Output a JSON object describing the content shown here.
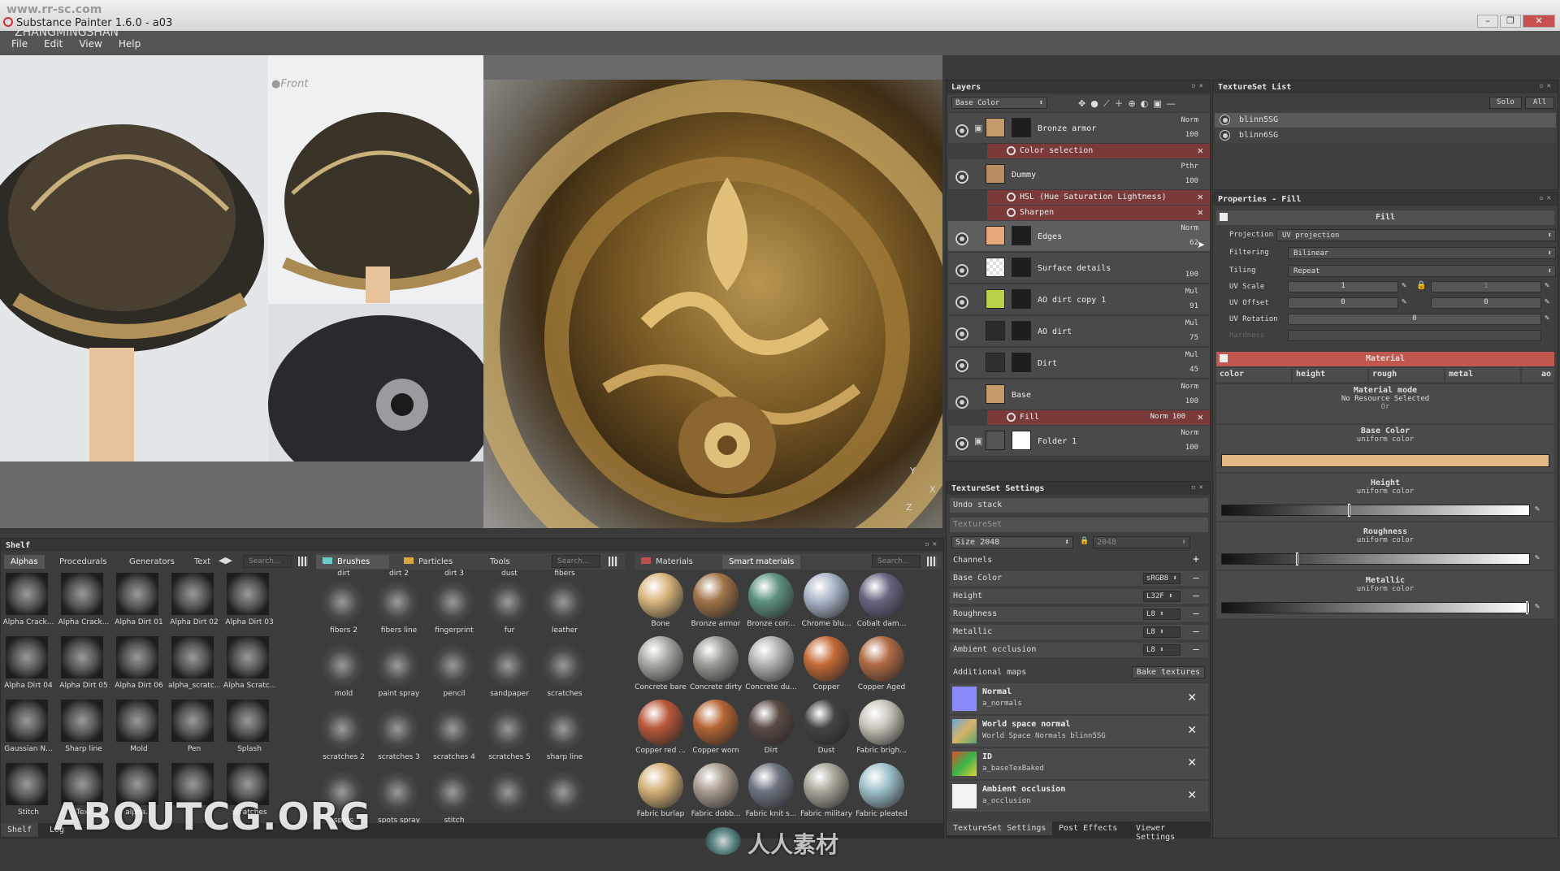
{
  "window": {
    "title": "Substance Painter 1.6.0 - a03",
    "watermark_top": "www.rr-sc.com",
    "watermark_top2": "ZHANGMINGSHAN",
    "watermark_bottom": "ABOUTCG.ORG",
    "watermark_center": "人人素材",
    "buttons": [
      "–",
      "❐",
      "✕"
    ]
  },
  "menu": [
    "File",
    "Edit",
    "View",
    "Help"
  ],
  "viewport": {
    "reference_label": "Front",
    "axis_y": "Y",
    "axis_z": "Z",
    "axis_x": "X"
  },
  "layers": {
    "title": "Layers",
    "channel_select": "Base Color",
    "items": [
      {
        "name": "Bronze armor",
        "blend": "Norm",
        "opacity": "100",
        "swatch": "#c39a6b",
        "is_folder": true
      },
      {
        "name": "Dummy",
        "blend": "Pthr",
        "opacity": "100",
        "swatch": "#b88d62"
      },
      {
        "name": "Edges",
        "blend": "Norm",
        "opacity": "62",
        "swatch": "#e9a87a",
        "selected": true
      },
      {
        "name": "Surface details",
        "blend": "",
        "opacity": "100",
        "swatch": "#f0f0f0"
      },
      {
        "name": "AO dirt copy 1",
        "blend": "Mul",
        "opacity": "91",
        "swatch": "#b7d24a"
      },
      {
        "name": "AO dirt",
        "blend": "Mul",
        "opacity": "75",
        "swatch": "#2b2b2b"
      },
      {
        "name": "Dirt",
        "blend": "Mul",
        "opacity": "45",
        "swatch": "#303030"
      },
      {
        "name": "Base",
        "blend": "Norm",
        "opacity": "100",
        "swatch": "#c69a6a"
      },
      {
        "name": "Folder 1",
        "blend": "Norm",
        "opacity": "100",
        "swatch": "#555555",
        "is_folder": true
      }
    ],
    "effects": {
      "color_selection": "Color selection",
      "hsl": "HSL (Hue Saturation Lightness)",
      "sharpen": "Sharpen",
      "fill": "Fill",
      "fill_blend": "Norm",
      "fill_opacity": "100"
    }
  },
  "textureset_list": {
    "title": "TextureSet List",
    "solo": "Solo",
    "all": "All",
    "items": [
      "blinn5SG",
      "blinn6SG"
    ]
  },
  "properties": {
    "title": "Properties - Fill",
    "fill_header": "Fill",
    "projection_label": "Projection",
    "projection_value": "UV projection",
    "filtering_label": "Filtering",
    "filtering_value": "Bilinear",
    "tiling_label": "Tiling",
    "tiling_value": "Repeat",
    "uv_scale_label": "UV Scale",
    "uv_scale_value": "1",
    "uv_scale_value2": "1",
    "uv_offset_label": "UV Offset",
    "uv_offset_value": "0",
    "uv_offset_value2": "0",
    "uv_rotation_label": "UV Rotation",
    "uv_rotation_value": "0",
    "hardness_label": "Hardness",
    "material_header": "Material",
    "channels": [
      "color",
      "height",
      "rough",
      "metal",
      "ao"
    ],
    "material_mode": "Material mode",
    "no_resource": "No Resource Selected",
    "or": "Or",
    "base_color": "Base Color",
    "uniform_color": "uniform color",
    "base_color_hex": "#e3b882",
    "height": "Height",
    "roughness": "Roughness",
    "metallic": "Metallic",
    "height_level": 0.41,
    "roughness_level": 0.24,
    "metallic_level": 0.99,
    "ramp_ticks": [
      "0",
      "0.1",
      "0.2",
      "0.3",
      "0.4",
      "0.5",
      "0.6",
      "0.7",
      "0.8",
      "0.9"
    ]
  },
  "textureset_settings": {
    "title": "TextureSet Settings",
    "undo_stack": "Undo stack",
    "textureset": "TextureSet",
    "size_label": "Size",
    "size_value": "2048",
    "size_value2": "2048",
    "channels_label": "Channels",
    "channels": [
      {
        "name": "Base Color",
        "format": "sRGB8"
      },
      {
        "name": "Height",
        "format": "L32F"
      },
      {
        "name": "Roughness",
        "format": "L8"
      },
      {
        "name": "Metallic",
        "format": "L8"
      },
      {
        "name": "Ambient occlusion",
        "format": "L8"
      }
    ],
    "additional_maps": "Additional maps",
    "bake_textures": "Bake textures",
    "maps": [
      {
        "name": "Normal",
        "file": "a_normals",
        "color": "#8a8aff"
      },
      {
        "name": "World space normal",
        "file": "World Space Normals blinn5SG",
        "color": "#8ab6d6"
      },
      {
        "name": "ID",
        "file": "a_baseTexBaked",
        "color": "#d9502f"
      },
      {
        "name": "Ambient occlusion",
        "file": "a_occlusion",
        "color": "#f2f2f2"
      }
    ],
    "bottom_tabs": [
      "TextureSet Settings",
      "Post Effects",
      "Viewer Settings"
    ]
  },
  "shelf": {
    "title": "Shelf",
    "tabs_left": [
      "Alphas",
      "Procedurals",
      "Generators",
      "Text"
    ],
    "search": "Search...",
    "alphas": [
      "Alpha Crack...",
      "Alpha Crack...",
      "Alpha Dirt 01",
      "Alpha Dirt 02",
      "Alpha Dirt 03",
      "Alpha Dirt 04",
      "Alpha Dirt 05",
      "Alpha Dirt 06",
      "alpha_scratc...",
      "Alpha Scratc...",
      "Gaussian N...",
      "Sharp line",
      "Mold",
      "Pen",
      "Splash",
      "Stitch",
      "Text",
      "alpha...",
      "",
      "scratches"
    ],
    "tabs_mid": [
      "Brushes",
      "Particles",
      "Tools"
    ],
    "brushes_top": [
      "dirt",
      "dirt 2",
      "dirt 3",
      "dust",
      "fibers"
    ],
    "brushes": [
      "fibers 2",
      "fibers line",
      "fingerprint",
      "fur",
      "leather",
      "mold",
      "paint spray",
      "pencil",
      "sandpaper",
      "scratches",
      "scratches 2",
      "scratches 3",
      "scratches 4",
      "scratches 5",
      "sharp line",
      "spots",
      "spots spray",
      "stitch",
      "",
      ""
    ],
    "tabs_right": [
      "Materials",
      "Smart materials"
    ],
    "materials": [
      {
        "name": "Bone",
        "color": "#d8b57c"
      },
      {
        "name": "Bronze armor",
        "color": "#a07448"
      },
      {
        "name": "Bronze corr...",
        "color": "#5d9180"
      },
      {
        "name": "Chrome blu...",
        "color": "#aab6c8"
      },
      {
        "name": "Cobalt dam...",
        "color": "#6a6480"
      },
      {
        "name": "Concrete bare",
        "color": "#a8a8a2"
      },
      {
        "name": "Concrete dirty",
        "color": "#9c9a94"
      },
      {
        "name": "Concrete du...",
        "color": "#b2b2b2"
      },
      {
        "name": "Copper",
        "color": "#c56a36"
      },
      {
        "name": "Copper Aged",
        "color": "#b06a44"
      },
      {
        "name": "Copper red ...",
        "color": "#b8583a"
      },
      {
        "name": "Copper worn",
        "color": "#b46434"
      },
      {
        "name": "Dirt",
        "color": "#5a4a44"
      },
      {
        "name": "Dust",
        "color": "#444444"
      },
      {
        "name": "Fabric brigh...",
        "color": "#c8c4b8"
      },
      {
        "name": "Fabric burlap",
        "color": "#d2b078"
      },
      {
        "name": "Fabric dobb...",
        "color": "#a89c8e"
      },
      {
        "name": "Fabric knit s...",
        "color": "#6c7480"
      },
      {
        "name": "Fabric military",
        "color": "#a8a698"
      },
      {
        "name": "Fabric pleated",
        "color": "#9cc0c8"
      }
    ],
    "bottom_tabs": [
      "Shelf",
      "Log"
    ]
  }
}
